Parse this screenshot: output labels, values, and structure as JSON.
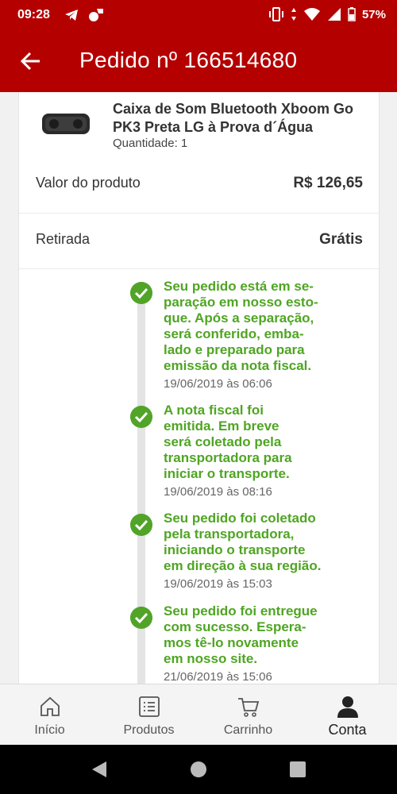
{
  "status_bar": {
    "time": "09:28",
    "battery": "57%"
  },
  "header": {
    "title": "Pedido nº 166514680"
  },
  "product": {
    "name": "Caixa de Som Bluetooth Xboom Go PK3 Preta LG à Prova d´Água",
    "quantity": "Quantidade: 1"
  },
  "summary": [
    {
      "label": "Valor do produto",
      "value": "R$ 126,65"
    },
    {
      "label": "Retirada",
      "value": "Grátis"
    }
  ],
  "timeline": [
    {
      "text": "Seu pedido está em se-\nparação em nosso esto-\nque. Após a separação,\nserá conferido, emba-\nlado e preparado para\nemissão da nota fiscal.",
      "date": "19/06/2019 às 06:06"
    },
    {
      "text": "A nota fiscal foi\nemitida. Em breve\nserá coletado pela\ntransportadora para\niniciar o transporte.",
      "date": "19/06/2019 às 08:16"
    },
    {
      "text": "Seu pedido foi coletado\npela transportadora,\niniciando o transporte\nem direção à sua região.",
      "date": "19/06/2019 às 15:03"
    },
    {
      "text": "Seu pedido foi entregue\ncom sucesso. Espera-\nmos tê-lo novamente\nem nosso site.",
      "date": "21/06/2019 às 15:06"
    }
  ],
  "bottom_nav": [
    {
      "label": "Início",
      "icon": "home-icon"
    },
    {
      "label": "Produtos",
      "icon": "list-icon"
    },
    {
      "label": "Carrinho",
      "icon": "cart-icon"
    },
    {
      "label": "Conta",
      "icon": "user-icon",
      "active": true
    }
  ],
  "colors": {
    "brand_red": "#b50000",
    "success_green": "#4fa523"
  }
}
